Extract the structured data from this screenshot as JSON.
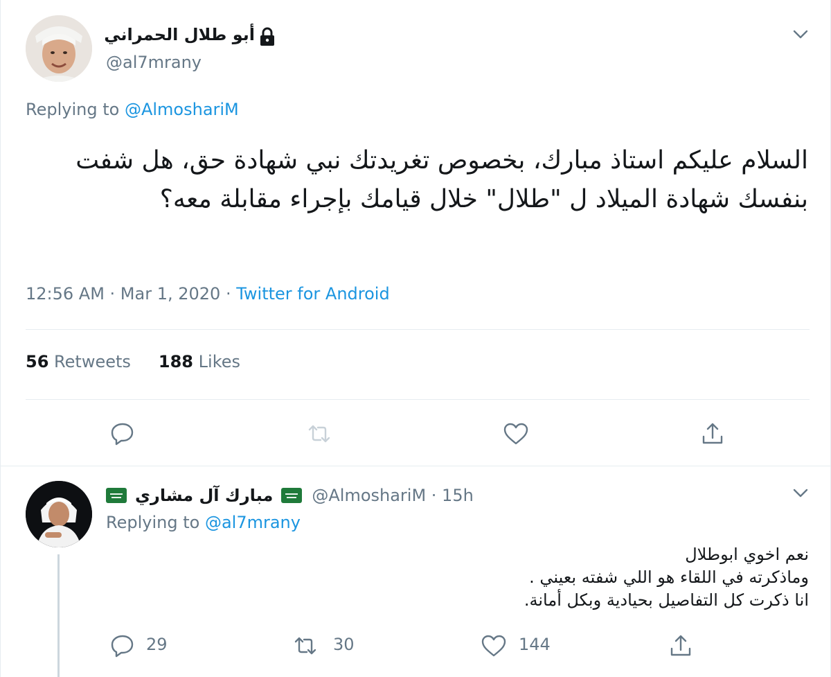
{
  "main_tweet": {
    "display_name": "أبو طلال الحمراني",
    "handle": "@al7mrany",
    "replying_prefix": "Replying to",
    "replying_mention": "@AlmoshariM",
    "text": "السلام عليكم استاذ مبارك، بخصوص تغريدتك نبي شهادة حق، هل شفت بنفسك شهادة الميلاد ل \"طلال\" خلال قيامك بإجراء مقابلة معه؟",
    "timestamp": "12:56 AM · Mar 1, 2020 · ",
    "source": "Twitter for Android",
    "retweets_count": "56",
    "retweets_label": "Retweets",
    "likes_count": "188",
    "likes_label": "Likes",
    "icons": [
      "lock-icon",
      "chevron-down-icon",
      "reply-icon",
      "retweet-icon",
      "like-icon",
      "share-icon"
    ]
  },
  "reply_tweet": {
    "display_name": "مبارك آل مشاري",
    "handle": "@AlmoshariM · 15h",
    "replying_prefix": "Replying to",
    "replying_mention": "@al7mrany",
    "lines": [
      "نعم اخوي ابوطلال",
      "وماذكرته في اللقاء هو اللي شفته بعيني .",
      "انا ذكرت كل التفاصيل بحيادية وبكل أمانة."
    ],
    "reply_count": "29",
    "retweet_count": "30",
    "like_count": "144",
    "icons": [
      "saudi-flag-icon",
      "chevron-down-icon",
      "reply-icon",
      "retweet-icon",
      "like-icon",
      "share-icon"
    ]
  },
  "colors": {
    "text": "#14171a",
    "secondary": "#657786",
    "link": "#1b95e0",
    "divider": "#e6ecf0",
    "flag": "#1f7a3a"
  }
}
